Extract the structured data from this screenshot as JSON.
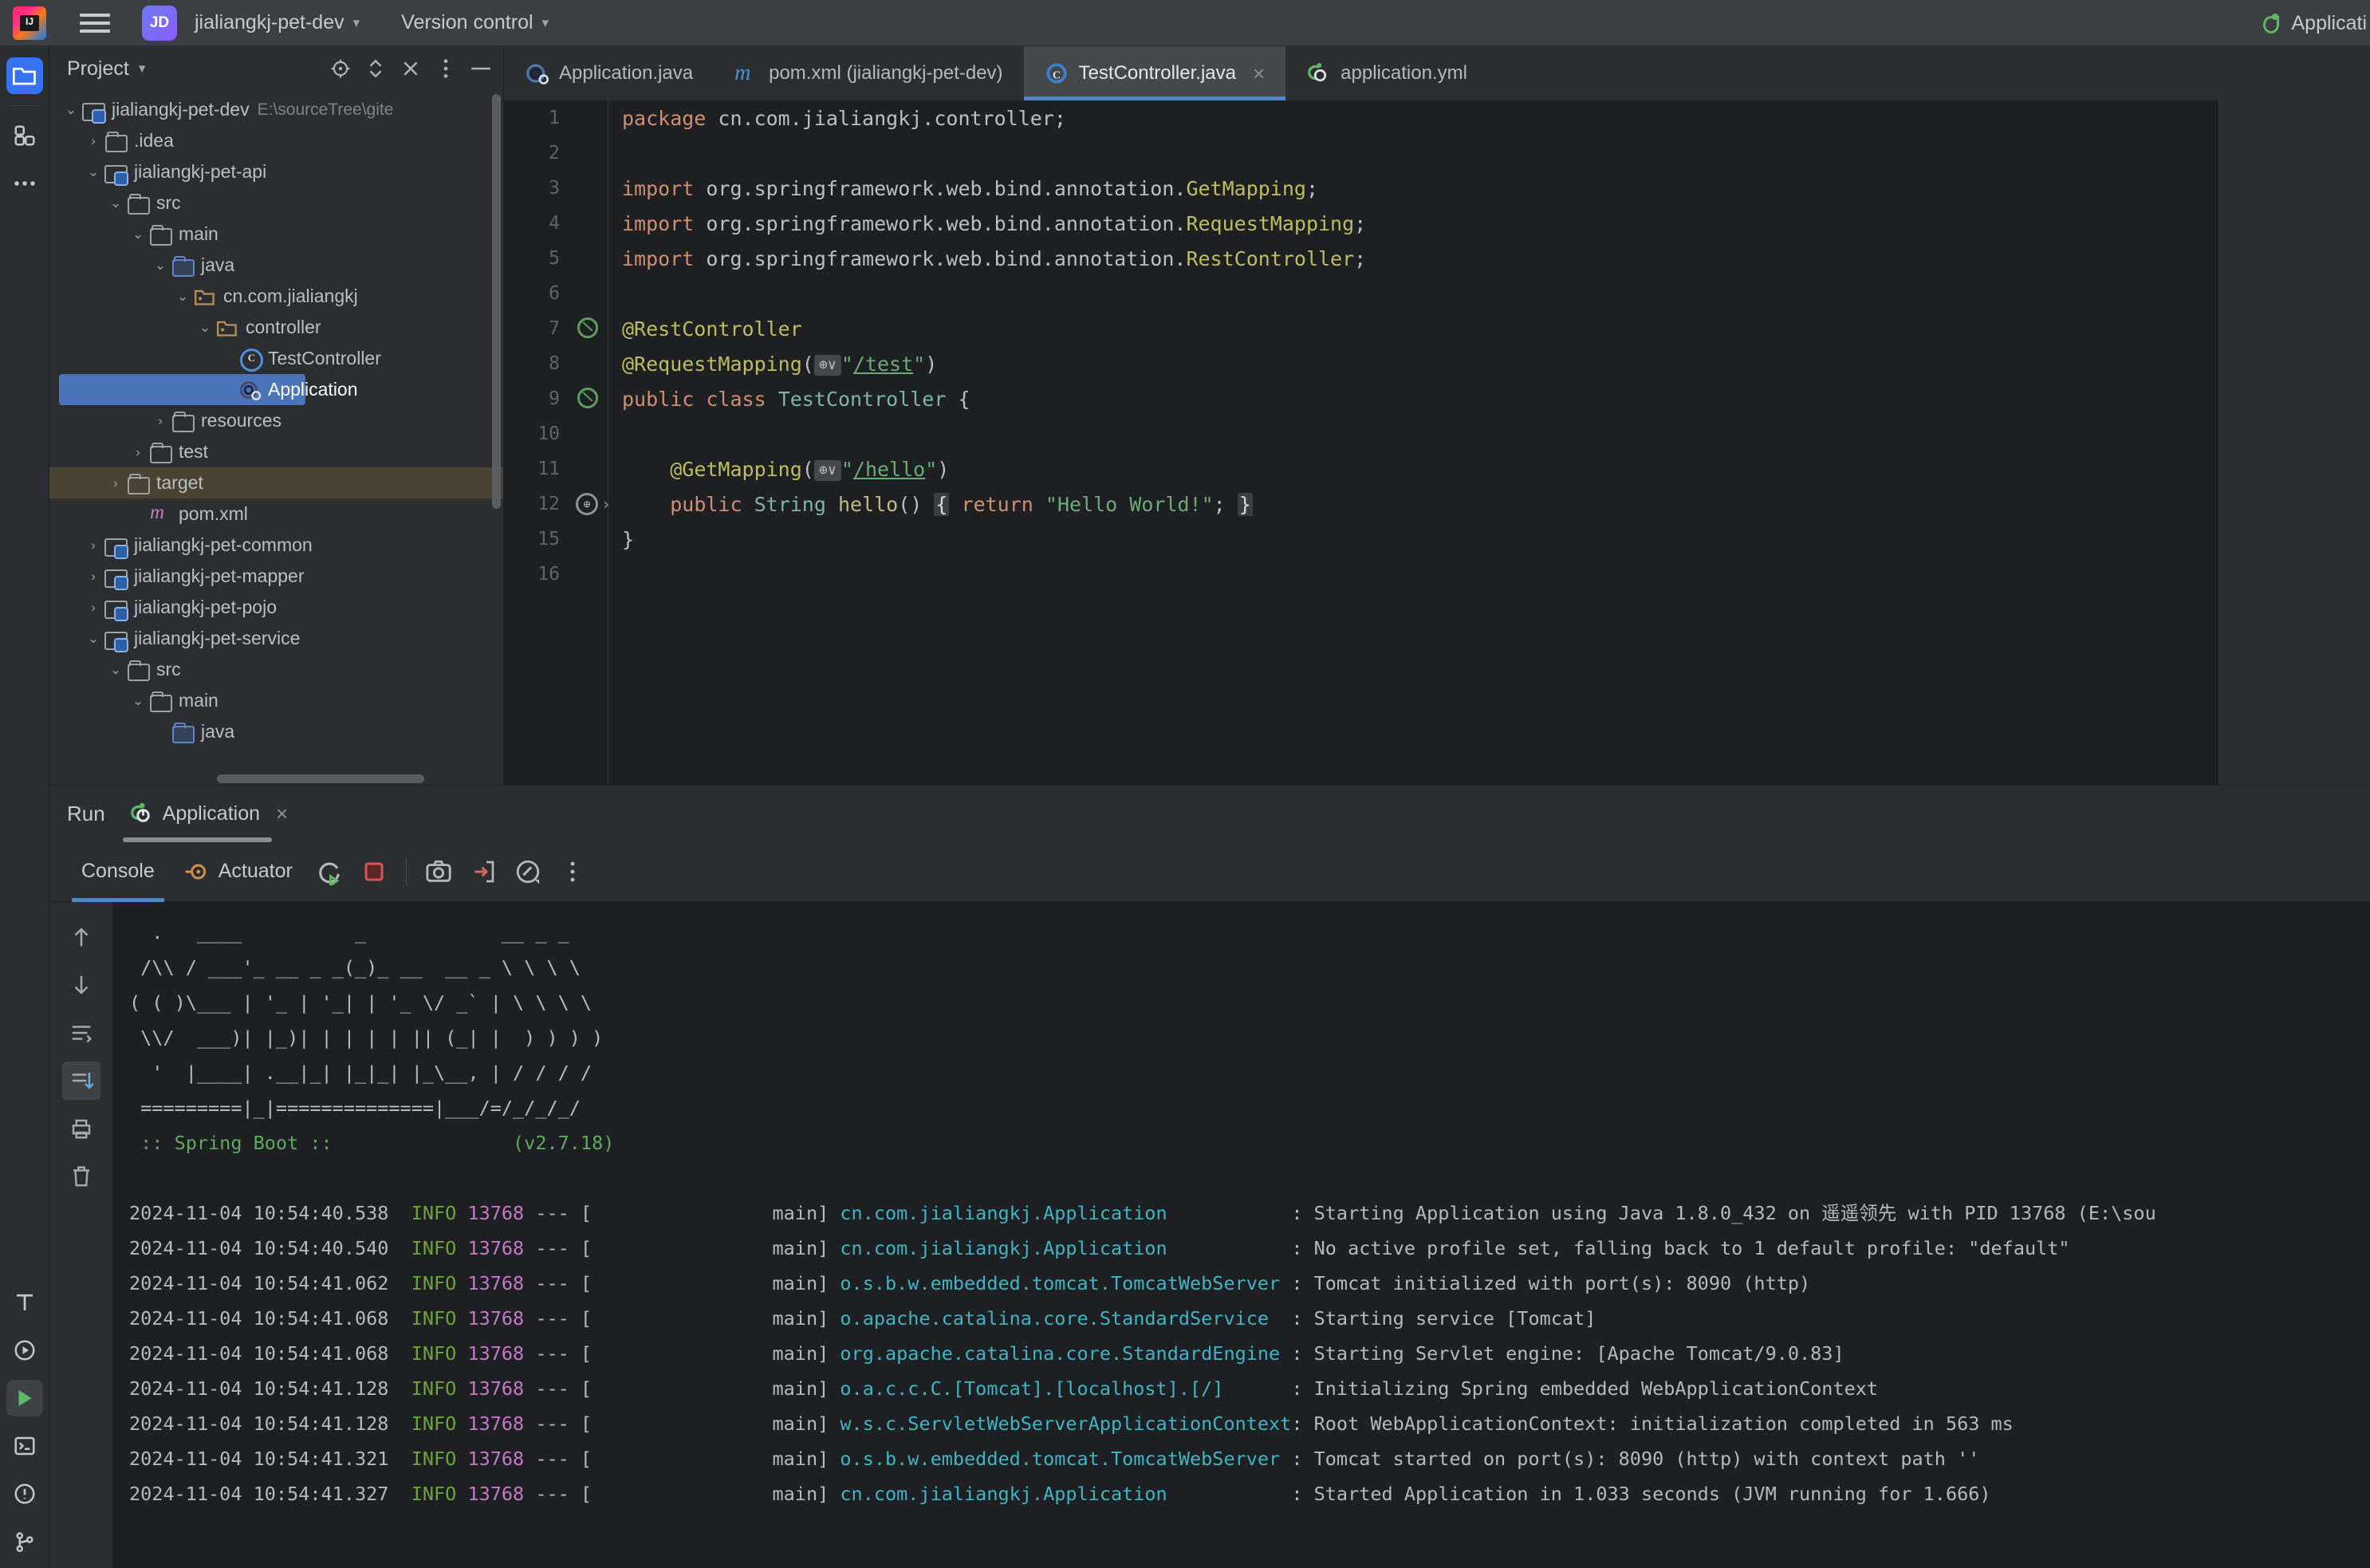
{
  "titlebar": {
    "project_badge": "JD",
    "project_name": "jialiangkj-pet-dev",
    "version_control": "Version control",
    "right_run_config": "Applicati"
  },
  "project_panel": {
    "title": "Project",
    "tree": [
      {
        "label": "jialiangkj-pet-dev",
        "path": "E:\\sourceTree\\gite",
        "indent": 0,
        "arrow": "v",
        "icon": "module-folder-icon"
      },
      {
        "label": ".idea",
        "path": "",
        "indent": 1,
        "arrow": ">",
        "icon": "folder-icon"
      },
      {
        "label": "jialiangkj-pet-api",
        "path": "",
        "indent": 1,
        "arrow": "v",
        "icon": "module-folder-icon"
      },
      {
        "label": "src",
        "path": "",
        "indent": 2,
        "arrow": "v",
        "icon": "folder-icon"
      },
      {
        "label": "main",
        "path": "",
        "indent": 3,
        "arrow": "v",
        "icon": "folder-icon"
      },
      {
        "label": "java",
        "path": "",
        "indent": 4,
        "arrow": "v",
        "icon": "source-folder-icon"
      },
      {
        "label": "cn.com.jialiangkj",
        "path": "",
        "indent": 5,
        "arrow": "v",
        "icon": "package-icon"
      },
      {
        "label": "controller",
        "path": "",
        "indent": 6,
        "arrow": "v",
        "icon": "package-icon"
      },
      {
        "label": "TestController",
        "path": "",
        "indent": 7,
        "arrow": "",
        "icon": "java-class-icon"
      },
      {
        "label": "Application",
        "path": "",
        "indent": 7,
        "arrow": "",
        "icon": "spring-boot-class-icon",
        "selected": true
      },
      {
        "label": "resources",
        "path": "",
        "indent": 4,
        "arrow": ">",
        "icon": "resource-folder-icon"
      },
      {
        "label": "test",
        "path": "",
        "indent": 3,
        "arrow": ">",
        "icon": "folder-icon"
      },
      {
        "label": "target",
        "path": "",
        "indent": 2,
        "arrow": ">",
        "icon": "folder-icon",
        "hilite": true
      },
      {
        "label": "pom.xml",
        "path": "",
        "indent": 3,
        "arrow": "",
        "icon": "maven-icon"
      },
      {
        "label": "jialiangkj-pet-common",
        "path": "",
        "indent": 1,
        "arrow": ">",
        "icon": "module-folder-icon"
      },
      {
        "label": "jialiangkj-pet-mapper",
        "path": "",
        "indent": 1,
        "arrow": ">",
        "icon": "module-folder-icon"
      },
      {
        "label": "jialiangkj-pet-pojo",
        "path": "",
        "indent": 1,
        "arrow": ">",
        "icon": "module-folder-icon"
      },
      {
        "label": "jialiangkj-pet-service",
        "path": "",
        "indent": 1,
        "arrow": "v",
        "icon": "module-folder-icon"
      },
      {
        "label": "src",
        "path": "",
        "indent": 2,
        "arrow": "v",
        "icon": "folder-icon"
      },
      {
        "label": "main",
        "path": "",
        "indent": 3,
        "arrow": "v",
        "icon": "folder-icon"
      },
      {
        "label": "java",
        "path": "",
        "indent": 4,
        "arrow": "",
        "icon": "source-folder-icon"
      }
    ]
  },
  "editor": {
    "tabs": [
      {
        "label": "Application.java",
        "icon": "spring-boot-class-icon",
        "active": false,
        "closable": false
      },
      {
        "label": "pom.xml (jialiangkj-pet-dev)",
        "icon": "maven-icon",
        "active": false,
        "closable": false
      },
      {
        "label": "TestController.java",
        "icon": "java-class-icon",
        "active": true,
        "closable": true
      },
      {
        "label": "application.yml",
        "icon": "spring-yaml-icon",
        "active": false,
        "closable": false
      }
    ],
    "close_glyph": "×",
    "lines": [
      {
        "no": "1",
        "gutter": "",
        "html": "<span class='k'>package</span> <span class='p'>cn.com.jialiangkj.controller;</span>"
      },
      {
        "no": "2",
        "gutter": "",
        "html": ""
      },
      {
        "no": "3",
        "gutter": "",
        "html": "<span class='k'>import</span> <span class='p'>org.springframework.web.bind.annotation.</span><span class='a'>GetMapping</span><span class='p'>;</span>"
      },
      {
        "no": "4",
        "gutter": "",
        "html": "<span class='k'>import</span> <span class='p'>org.springframework.web.bind.annotation.</span><span class='a'>RequestMapping</span><span class='p'>;</span>"
      },
      {
        "no": "5",
        "gutter": "",
        "html": "<span class='k'>import</span> <span class='p'>org.springframework.web.bind.annotation.</span><span class='a'>RestController</span><span class='p'>;</span>"
      },
      {
        "no": "6",
        "gutter": "",
        "html": ""
      },
      {
        "no": "7",
        "gutter": "inspect",
        "html": "<span class='a'>@RestController</span>"
      },
      {
        "no": "8",
        "gutter": "",
        "html": "<span class='a'>@RequestMapping</span><span class='p'>(</span><span class='globe'>⊕∨</span><span class='s'>\"</span><span class='u'>/test</span><span class='s'>\"</span><span class='p'>)</span>"
      },
      {
        "no": "9",
        "gutter": "inspect",
        "html": "<span class='k'>public class</span> <span class='t'>TestController</span> <span class='p'>{</span>"
      },
      {
        "no": "10",
        "gutter": "",
        "html": ""
      },
      {
        "no": "11",
        "gutter": "",
        "html": "    <span class='a'>@GetMapping</span><span class='p'>(</span><span class='globe'>⊕∨</span><span class='s'>\"</span><span class='u'>/hello</span><span class='s'>\"</span><span class='p'>)</span>"
      },
      {
        "no": "12",
        "gutter": "web-run",
        "html": "    <span class='k'>public</span> <span class='t'>String</span> <span class='m'>hello</span><span class='p'>()</span> <span class='fold'>{</span> <span class='k'>return</span> <span class='s'>\"Hello World!\"</span><span class='p'>;</span> <span class='fold'>}</span>"
      },
      {
        "no": "15",
        "gutter": "",
        "html": "<span class='p'>}</span>"
      },
      {
        "no": "16",
        "gutter": "",
        "html": ""
      }
    ]
  },
  "run_panel": {
    "label": "Run",
    "tab_name": "Application",
    "tab_close": "×",
    "toolbar_tabs": [
      {
        "label": "Console",
        "selected": true,
        "icon": ""
      },
      {
        "label": "Actuator",
        "selected": false,
        "icon": "actuator-icon"
      }
    ],
    "toolbar_buttons": [
      "rerun-button",
      "stop-button",
      "screenshot-button",
      "export-button",
      "profiler-button",
      "more-options-button"
    ],
    "gutter_buttons": [
      "scroll-up-button",
      "scroll-down-button",
      "soft-wrap-button",
      "scroll-to-end-button",
      "print-button",
      "clear-all-button"
    ],
    "console": {
      "banner": [
        "  .   ____          _            __ _ _",
        " /\\\\ / ___'_ __ _ _(_)_ __  __ _ \\ \\ \\ \\",
        "( ( )\\___ | '_ | '_| | '_ \\/ _` | \\ \\ \\ \\",
        " \\\\/  ___)| |_)| | | | | || (_| |  ) ) ) )",
        "  '  |____| .__|_| |_|_| |_\\__, | / / / /",
        " =========|_|==============|___/=/_/_/_/"
      ],
      "spring_line": " :: Spring Boot ::                (v2.7.18)",
      "logs": [
        {
          "ts": "2024-11-04 10:54:40.538",
          "level": "INFO",
          "pid": "13768",
          "thread": "main",
          "cls": "cn.com.jialiangkj.Application",
          "msg": "Starting Application using Java 1.8.0_432 on 遥遥领先 with PID 13768 (E:\\sou"
        },
        {
          "ts": "2024-11-04 10:54:40.540",
          "level": "INFO",
          "pid": "13768",
          "thread": "main",
          "cls": "cn.com.jialiangkj.Application",
          "msg": "No active profile set, falling back to 1 default profile: \"default\""
        },
        {
          "ts": "2024-11-04 10:54:41.062",
          "level": "INFO",
          "pid": "13768",
          "thread": "main",
          "cls": "o.s.b.w.embedded.tomcat.TomcatWebServer",
          "msg": "Tomcat initialized with port(s): 8090 (http)"
        },
        {
          "ts": "2024-11-04 10:54:41.068",
          "level": "INFO",
          "pid": "13768",
          "thread": "main",
          "cls": "o.apache.catalina.core.StandardService",
          "msg": "Starting service [Tomcat]"
        },
        {
          "ts": "2024-11-04 10:54:41.068",
          "level": "INFO",
          "pid": "13768",
          "thread": "main",
          "cls": "org.apache.catalina.core.StandardEngine",
          "msg": "Starting Servlet engine: [Apache Tomcat/9.0.83]"
        },
        {
          "ts": "2024-11-04 10:54:41.128",
          "level": "INFO",
          "pid": "13768",
          "thread": "main",
          "cls": "o.a.c.c.C.[Tomcat].[localhost].[/]",
          "msg": "Initializing Spring embedded WebApplicationContext"
        },
        {
          "ts": "2024-11-04 10:54:41.128",
          "level": "INFO",
          "pid": "13768",
          "thread": "main",
          "cls": "w.s.c.ServletWebServerApplicationContext",
          "msg": "Root WebApplicationContext: initialization completed in 563 ms"
        },
        {
          "ts": "2024-11-04 10:54:41.321",
          "level": "INFO",
          "pid": "13768",
          "thread": "main",
          "cls": "o.s.b.w.embedded.tomcat.TomcatWebServer",
          "msg": "Tomcat started on port(s): 8090 (http) with context path ''"
        },
        {
          "ts": "2024-11-04 10:54:41.327",
          "level": "INFO",
          "pid": "13768",
          "thread": "main",
          "cls": "cn.com.jialiangkj.Application",
          "msg": "Started Application in 1.033 seconds (JVM running for 1.666)"
        }
      ]
    }
  },
  "colors": {
    "accent": "#3573f0",
    "selection": "#4a73b8",
    "editor_bg": "#1e1f22",
    "panel_bg": "#2b2d30"
  }
}
